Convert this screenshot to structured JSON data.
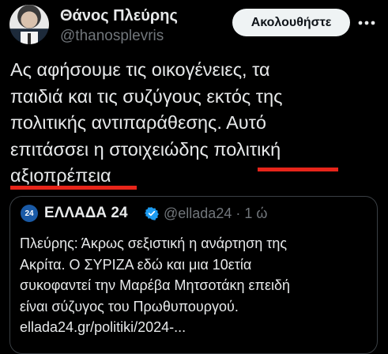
{
  "author": {
    "display_name": "Θάνος Πλεύρης",
    "handle": "@thanosplevris"
  },
  "follow_button": {
    "label": "Ακολουθήστε"
  },
  "more_icon": "more-options-icon",
  "tweet": {
    "text": "Ας αφήσουμε τις οικογένειες, τα\nπαιδιά και τις συζύγους εκτός της\nπολιτικής αντιπαράθεσης. Αυτό\nεπιτάσσει η στοιχειώδης πολιτική\nαξιοπρέπεια"
  },
  "quote": {
    "account_name": "ΕΛΛΑΔΑ 24",
    "avatar_label": "24",
    "handle": "@ellada24",
    "separator": "·",
    "time": "1 ώ",
    "text": "Πλεύρης: Άκρως σεξιστική η ανάρτηση της\nΑκρίτα. Ο ΣΥΡΙΖΑ εδώ και μια 10ετία\nσυκοφαντεί την Μαρέβα Μητσοτάκη επειδή\nείναι σύζυγος του Πρωθυπουργού.\nellada24.gr/politiki/2024-..."
  },
  "colors": {
    "background": "#000000",
    "text": "#e7e9ea",
    "secondary_text": "#71767b",
    "verified_badge": "#1d9bf0",
    "underline_annotation": "#e7251a"
  }
}
